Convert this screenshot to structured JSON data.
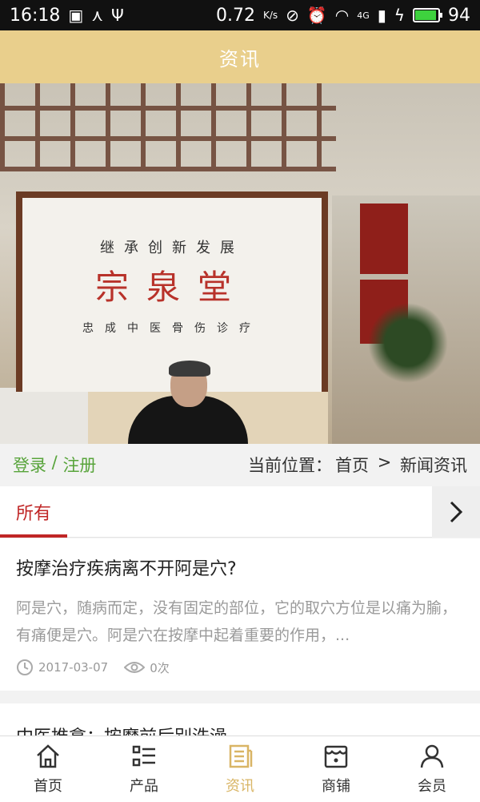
{
  "status_bar": {
    "time": "16:18",
    "speed": "0.72",
    "speed_unit": "K/s",
    "network": "4G",
    "battery": "94",
    "battery_level": 0.94
  },
  "header": {
    "title": "资讯"
  },
  "hero": {
    "motto": "继承创新发展",
    "brand": "宗泉堂",
    "subtitle": "忠成中医骨伤诊疗"
  },
  "auth": {
    "login": "登录",
    "separator": " / ",
    "register": "注册"
  },
  "breadcrumb": {
    "prefix": "当前位置：",
    "home": "首页",
    "arrow": " > ",
    "current": "新闻资讯"
  },
  "tabs": {
    "active": "所有",
    "more_icon": "chevron-right-icon"
  },
  "news": [
    {
      "title": "按摩治疗疾病离不开阿是穴?",
      "summary": "阿是穴，随病而定，没有固定的部位，它的取穴方位是以痛为腧，有痛便是穴。阿是穴在按摩中起着重要的作用，...",
      "date": "2017-03-07",
      "views": "0次"
    },
    {
      "title": "中医推拿：按摩前后别洗澡"
    }
  ],
  "bottom_nav": [
    {
      "label": "首页",
      "icon": "home-icon"
    },
    {
      "label": "产品",
      "icon": "list-icon"
    },
    {
      "label": "资讯",
      "icon": "news-icon",
      "active": true
    },
    {
      "label": "商铺",
      "icon": "shop-icon"
    },
    {
      "label": "会员",
      "icon": "user-icon"
    }
  ],
  "colors": {
    "header_bg": "#e9cf8c",
    "accent_red": "#c02626",
    "auth_green": "#58a43b",
    "nav_active": "#d9b565"
  }
}
